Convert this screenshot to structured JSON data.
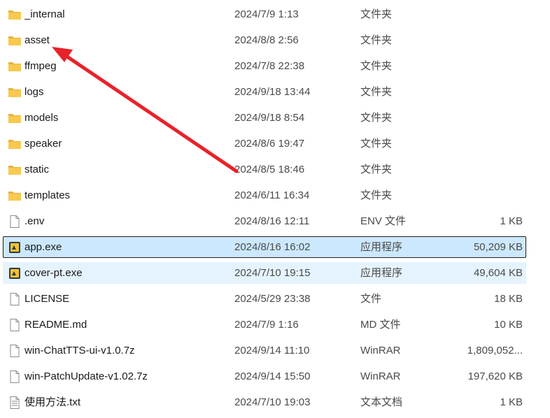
{
  "files": [
    {
      "name": "_internal",
      "date": "2024/7/9 1:13",
      "type": "文件夹",
      "size": "",
      "icon": "folder-icon"
    },
    {
      "name": "asset",
      "date": "2024/8/8 2:56",
      "type": "文件夹",
      "size": "",
      "icon": "folder-icon"
    },
    {
      "name": "ffmpeg",
      "date": "2024/7/8 22:38",
      "type": "文件夹",
      "size": "",
      "icon": "folder-icon"
    },
    {
      "name": "logs",
      "date": "2024/9/18 13:44",
      "type": "文件夹",
      "size": "",
      "icon": "folder-icon"
    },
    {
      "name": "models",
      "date": "2024/9/18 8:54",
      "type": "文件夹",
      "size": "",
      "icon": "folder-icon"
    },
    {
      "name": "speaker",
      "date": "2024/8/6 19:47",
      "type": "文件夹",
      "size": "",
      "icon": "folder-icon"
    },
    {
      "name": "static",
      "date": "2024/8/5 18:46",
      "type": "文件夹",
      "size": "",
      "icon": "folder-icon"
    },
    {
      "name": "templates",
      "date": "2024/6/11 16:34",
      "type": "文件夹",
      "size": "",
      "icon": "folder-icon"
    },
    {
      "name": ".env",
      "date": "2024/8/16 12:11",
      "type": "ENV 文件",
      "size": "1 KB",
      "icon": "file-icon"
    },
    {
      "name": "app.exe",
      "date": "2024/8/16 16:02",
      "type": "应用程序",
      "size": "50,209 KB",
      "icon": "exe-icon"
    },
    {
      "name": "cover-pt.exe",
      "date": "2024/7/10 19:15",
      "type": "应用程序",
      "size": "49,604 KB",
      "icon": "exe-icon"
    },
    {
      "name": "LICENSE",
      "date": "2024/5/29 23:38",
      "type": "文件",
      "size": "18 KB",
      "icon": "file-icon"
    },
    {
      "name": "README.md",
      "date": "2024/7/9 1:16",
      "type": "MD 文件",
      "size": "10 KB",
      "icon": "file-icon"
    },
    {
      "name": "win-ChatTTS-ui-v1.0.7z",
      "date": "2024/9/14 11:10",
      "type": "WinRAR",
      "size": "1,809,052...",
      "icon": "file-icon"
    },
    {
      "name": "win-PatchUpdate-v1.02.7z",
      "date": "2024/9/14 15:50",
      "type": "WinRAR",
      "size": "197,620 KB",
      "icon": "file-icon"
    },
    {
      "name": "使用方法.txt",
      "date": "2024/7/10 19:03",
      "type": "文本文档",
      "size": "1 KB",
      "icon": "text-file-icon"
    }
  ],
  "colors": {
    "folder": "#f8c94e",
    "selected_bg": "#cce8ff",
    "hover_bg": "#e5f3ff",
    "arrow": "#e8222a"
  }
}
